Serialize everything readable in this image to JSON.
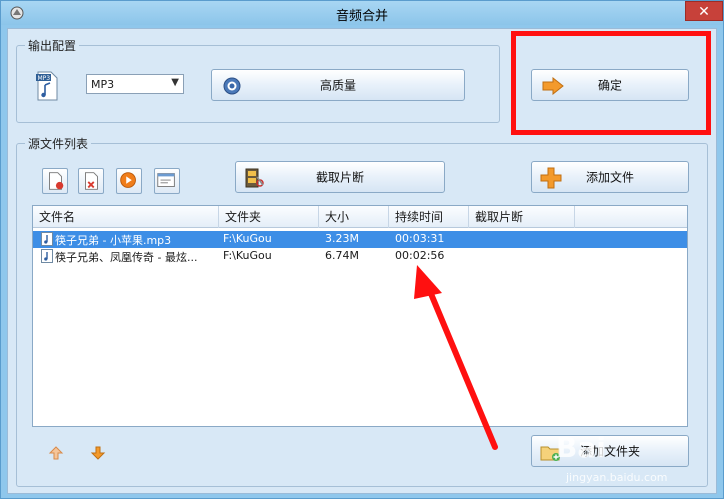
{
  "window": {
    "title": "音频合并",
    "close_glyph": "✕"
  },
  "output_config": {
    "group_label": "输出配置",
    "format_icon_text": "MP3",
    "format_select": "MP3",
    "quality_button": "高质量",
    "confirm_button": "确定"
  },
  "source_list": {
    "group_label": "源文件列表",
    "cut_button": "截取片断",
    "add_file_button": "添加文件",
    "add_folder_button": "添加文件夹",
    "columns": [
      "文件名",
      "文件夹",
      "大小",
      "持续时间",
      "截取片断"
    ],
    "rows": [
      {
        "name": "筷子兄弟 - 小苹果.mp3",
        "folder": "F:\\KuGou",
        "size": "3.23M",
        "duration": "00:03:31",
        "cut": ""
      },
      {
        "name": "筷子兄弟、凤凰传奇 - 最炫...",
        "folder": "F:\\KuGou",
        "size": "6.74M",
        "duration": "00:02:56",
        "cut": ""
      }
    ]
  },
  "watermark": {
    "brand": "Bai",
    "sub": "jingyan.baidu.com"
  },
  "colors": {
    "highlight": "#ff1010",
    "arrow": "#ff1010",
    "selected_row": "#3d8ee6"
  }
}
